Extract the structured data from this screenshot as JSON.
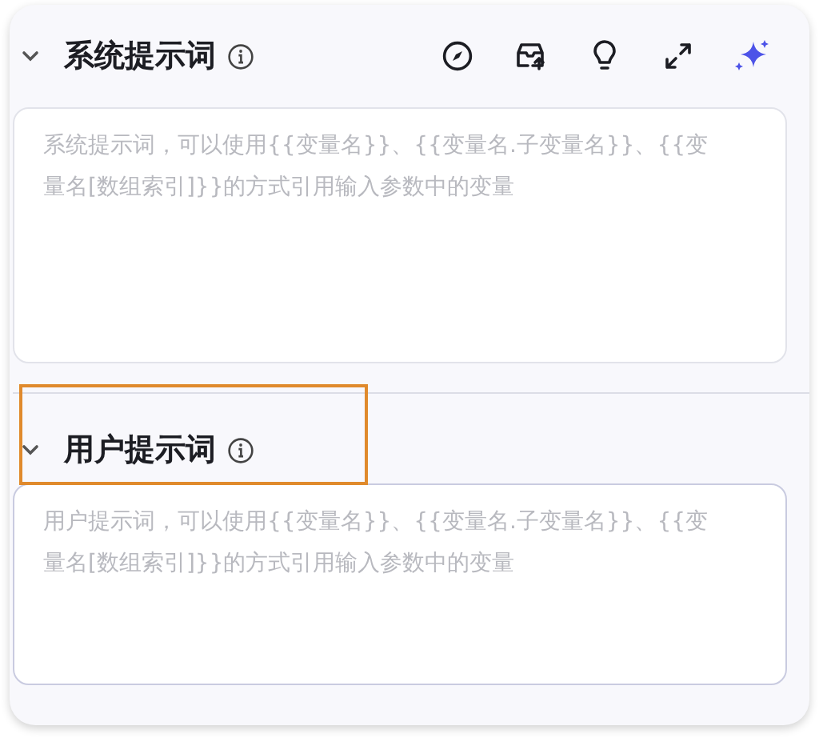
{
  "sections": [
    {
      "title": "系统提示词",
      "expanded": true,
      "highlighted": false,
      "toolbar": true,
      "placeholder": "系统提示词，可以使用{{变量名}}、{{变量名.子变量名}}、{{变量名[数组索引]}}的方式引用输入参数中的变量"
    },
    {
      "title": "用户提示词",
      "expanded": true,
      "highlighted": true,
      "toolbar": false,
      "placeholder": "用户提示词，可以使用{{变量名}}、{{变量名.子变量名}}、{{变量名[数组索引]}}的方式引用输入参数中的变量"
    }
  ]
}
